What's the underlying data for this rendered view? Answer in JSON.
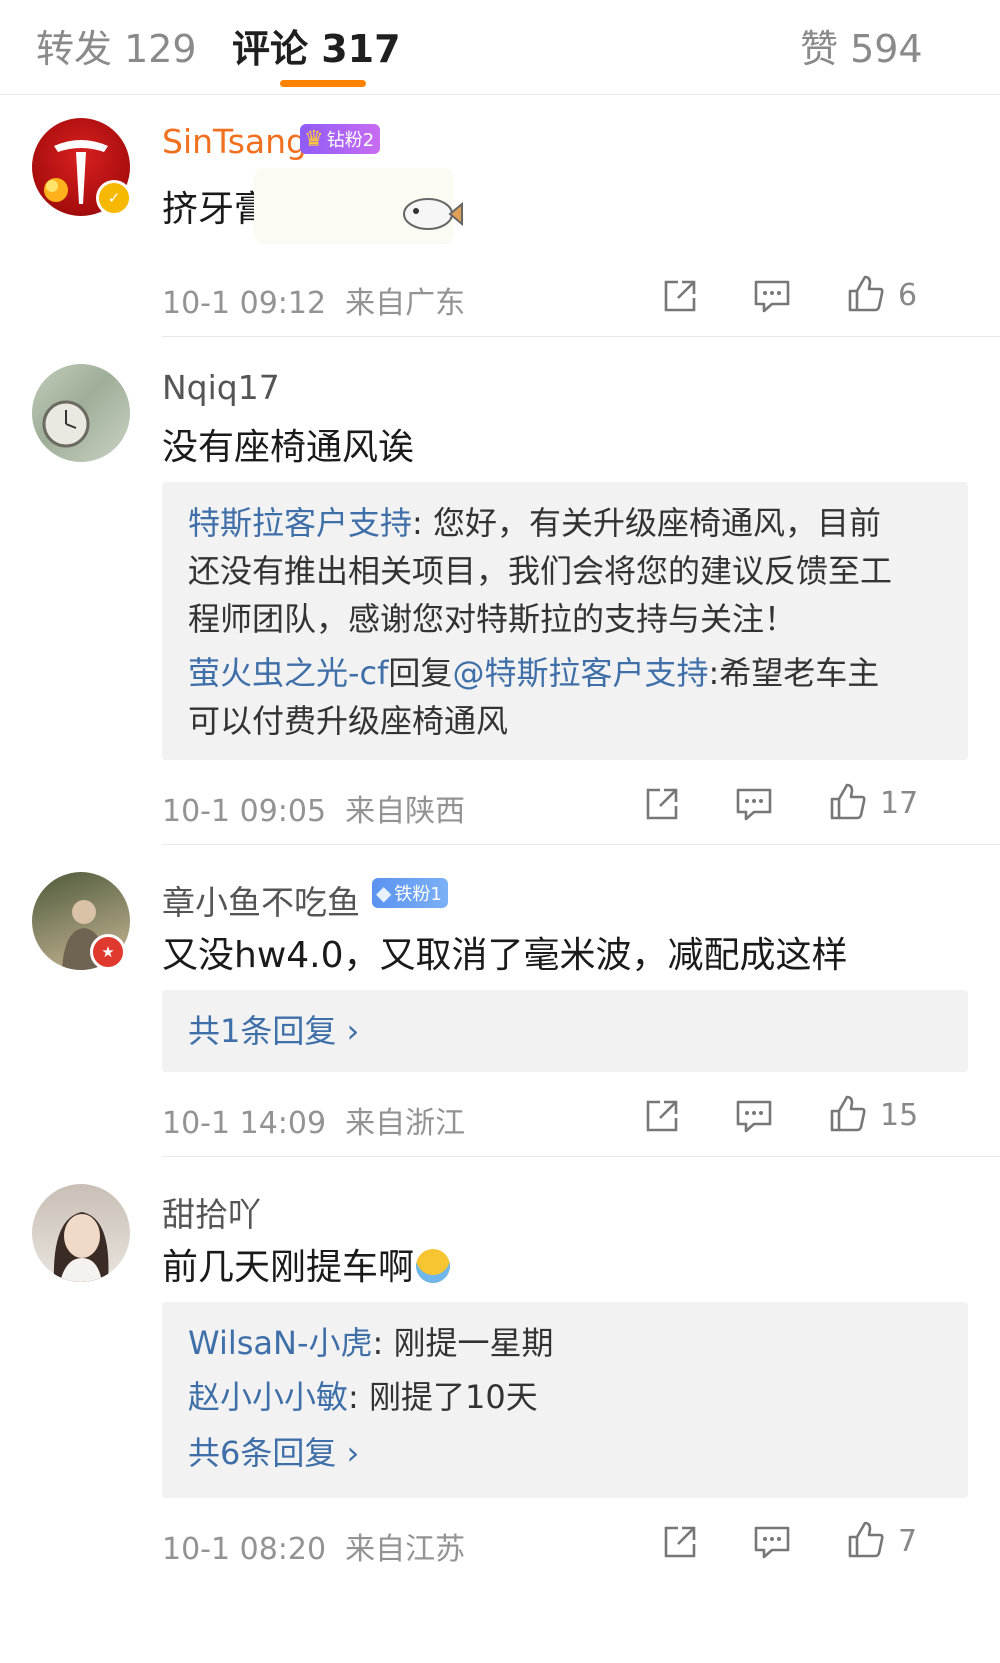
{
  "tabs": {
    "repost": "转发 129",
    "comment": "评论 317",
    "like": "赞 594"
  },
  "comments": [
    {
      "name": "SinTsang",
      "fan_badge": "钻粉2",
      "text": "挤牙膏",
      "time": "10-1 09:12",
      "location": "来自广东",
      "likes": "6"
    },
    {
      "name": "Nqiq17",
      "text": "没有座椅通风诶",
      "time": "10-1 09:05",
      "location": "来自陕西",
      "likes": "17",
      "replies": {
        "r1_user": "特斯拉客户支持",
        "r1_line1": ": 您好，有关升级座椅通风，目前",
        "r1_line2": "还没有推出相关项目，我们会将您的建议反馈至工",
        "r1_line3": "程师团队，感谢您对特斯拉的支持与关注！",
        "r2_user": "萤火虫之光-cf",
        "r2_reply_word": "回复",
        "r2_mention": "@特斯拉客户支持",
        "r2_text": ":希望老车主",
        "r2_line2": "可以付费升级座椅通风"
      }
    },
    {
      "name": "章小鱼不吃鱼",
      "fan_badge": "铁粉1",
      "text": "又没hw4.0，又取消了毫米波，减配成这样",
      "time": "10-1 14:09",
      "location": "来自浙江",
      "likes": "15",
      "reply_total": "共1条回复 ›"
    },
    {
      "name": "甜拾吖",
      "text": "前几天刚提车啊",
      "time": "10-1 08:20",
      "location": "来自江苏",
      "likes": "7",
      "replies": {
        "r1_user": "WilsaN-小虎",
        "r1_text": ": 刚提一星期",
        "r2_user": "赵小小小敏",
        "r2_text": ": 刚提了10天"
      },
      "reply_total": "共6条回复 ›"
    }
  ],
  "colors": {
    "accent": "#ff8200",
    "link": "#3f6fa8",
    "vip_name": "#f0701f"
  },
  "icons": [
    "share-icon",
    "comment-icon",
    "like-icon",
    "verified-icon",
    "crown-icon",
    "diamond-icon"
  ]
}
